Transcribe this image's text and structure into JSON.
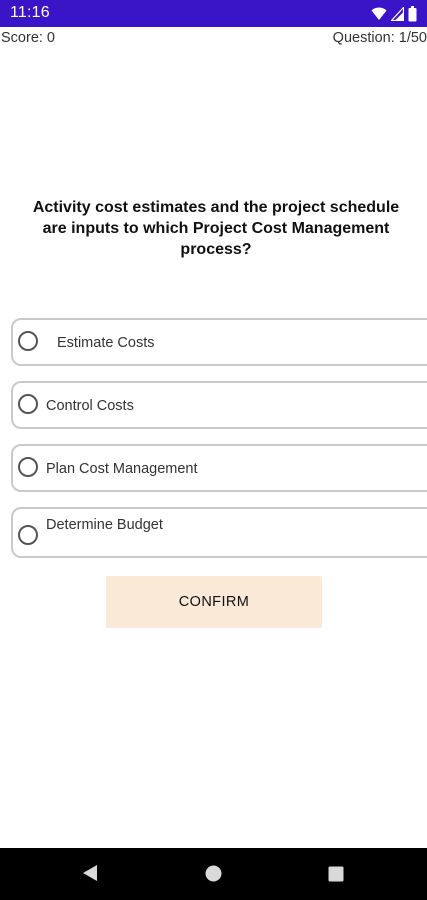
{
  "status_bar": {
    "time": "11:16",
    "background": "#3a15c7",
    "icons": [
      "wifi-icon",
      "signal-icon",
      "battery-icon"
    ]
  },
  "header": {
    "score": "Score: 0",
    "question_counter": "Question: 1/50"
  },
  "question": {
    "text": "Activity cost estimates and the project schedule are inputs to which Project Cost Management process?"
  },
  "options": [
    {
      "label": "Estimate Costs",
      "selected": false
    },
    {
      "label": "Control Costs",
      "selected": false
    },
    {
      "label": "Plan Cost Management",
      "selected": false
    },
    {
      "label": "Determine Budget",
      "selected": false
    }
  ],
  "confirm_button": {
    "label": "CONFIRM",
    "background": "#f9e9d6"
  },
  "nav_bar": {
    "icons": [
      "back-icon",
      "home-icon",
      "recents-icon"
    ]
  }
}
